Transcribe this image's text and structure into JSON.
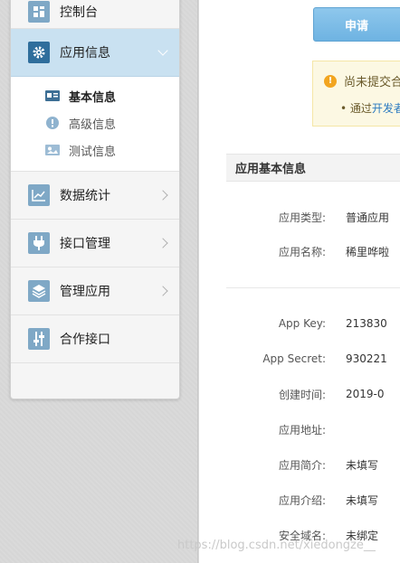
{
  "sidebar": {
    "items": [
      {
        "label": "控制台",
        "icon": "dashboard-icon"
      },
      {
        "label": "应用信息",
        "icon": "gear-icon",
        "expanded": true
      },
      {
        "label": "数据统计",
        "icon": "chart-icon"
      },
      {
        "label": "接口管理",
        "icon": "plug-icon"
      },
      {
        "label": "管理应用",
        "icon": "layers-icon"
      },
      {
        "label": "合作接口",
        "icon": "sliders-icon"
      }
    ],
    "sub_items": [
      {
        "label": "基本信息",
        "icon": "id-card-icon",
        "active": true
      },
      {
        "label": "高级信息",
        "icon": "exclamation-icon"
      },
      {
        "label": "测试信息",
        "icon": "image-icon"
      }
    ]
  },
  "main": {
    "apply_button": "申请",
    "notice": {
      "line1": "尚未提交合",
      "line2_prefix": "通过",
      "line2_link": "开发者"
    },
    "section_title": "应用基本信息",
    "fields": [
      {
        "label": "应用类型:",
        "value": "普通应用"
      },
      {
        "label": "应用名称:",
        "value": "稀里哗啦"
      },
      {
        "label": "App Key:",
        "value": "213830"
      },
      {
        "label": "App Secret:",
        "value": "930221"
      },
      {
        "label": "创建时间:",
        "value": "2019-0"
      },
      {
        "label": "应用地址:",
        "value": ""
      },
      {
        "label": "应用简介:",
        "value": "未填写"
      },
      {
        "label": "应用介绍:",
        "value": "未填写"
      },
      {
        "label": "安全域名:",
        "value": "未绑定"
      }
    ]
  },
  "watermark": "https://blog.csdn.net/xiedongze__"
}
